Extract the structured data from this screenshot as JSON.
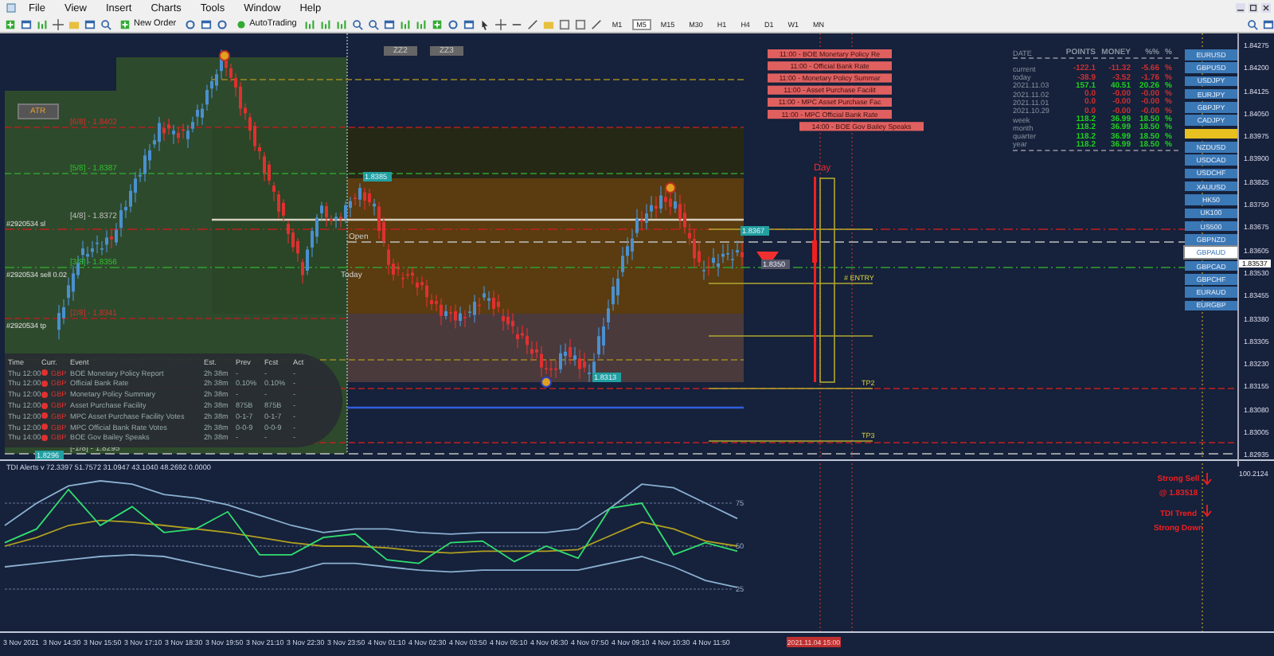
{
  "menu": [
    "File",
    "View",
    "Insert",
    "Charts",
    "Tools",
    "Window",
    "Help"
  ],
  "toolbar": {
    "new_order": "New Order",
    "autotrading": "AutoTrading",
    "timeframes": [
      {
        "label": "M1",
        "selected": false
      },
      {
        "label": "M5",
        "selected": true
      },
      {
        "label": "M15",
        "selected": false
      },
      {
        "label": "M30",
        "selected": false
      },
      {
        "label": "H1",
        "selected": false
      },
      {
        "label": "H4",
        "selected": false
      },
      {
        "label": "D1",
        "selected": false
      },
      {
        "label": "W1",
        "selected": false
      },
      {
        "label": "MN",
        "selected": false
      }
    ]
  },
  "chart": {
    "atr_button": "ATR",
    "zone_buttons": [
      "ZZ2",
      "ZZ3"
    ],
    "level_labels": [
      "[6/8] - 1.8402",
      "[5/8] - 1.8387",
      "[4/8] - 1.8372",
      "[3/8] - 1.8356",
      "[2/8] - 1.8341",
      "[-1/8] - 1.8295"
    ],
    "order_labels": [
      "#2920534 sl",
      "#2920534 sell 0.02",
      "#2920534 tp"
    ],
    "markers": [
      "Open",
      "Today"
    ],
    "price_tags": [
      "1.8385",
      "1.8367",
      "1.8350",
      "1.8313",
      "1.8296"
    ],
    "trade_labels": [
      "Day",
      "# ENTRY",
      "TP2",
      "TP3"
    ],
    "event_labels": [
      "11:00 - BOE Monetary Policy Re",
      "11:00 - Official Bank Rate",
      "11:00 - Monetary Policy Summar",
      "11:00 - Asset Purchase Facilit",
      "11:00 - MPC Asset Purchase Fac",
      "11:00 - MPC Official Bank Rate",
      "14:00 - BOE Gov Bailey Speaks"
    ],
    "news": {
      "columns": [
        "Time",
        "Curr.",
        "Event",
        "Est.",
        "Prev",
        "Fcst",
        "Act"
      ],
      "rows": [
        {
          "time": "Thu 12:00",
          "currency": "GBP",
          "event": "BOE Monetary Policy Report",
          "est": "2h 38m",
          "prev": "-",
          "fcst": "-",
          "act": "-"
        },
        {
          "time": "Thu 12:00",
          "currency": "GBP",
          "event": "Official Bank Rate",
          "est": "2h 38m",
          "prev": "0.10%",
          "fcst": "0.10%",
          "act": "-"
        },
        {
          "time": "Thu 12:00",
          "currency": "GBP",
          "event": "Monetary Policy Summary",
          "est": "2h 38m",
          "prev": "-",
          "fcst": "-",
          "act": "-"
        },
        {
          "time": "Thu 12:00",
          "currency": "GBP",
          "event": "Asset Purchase Facility",
          "est": "2h 38m",
          "prev": "875B",
          "fcst": "875B",
          "act": "-"
        },
        {
          "time": "Thu 12:00",
          "currency": "GBP",
          "event": "MPC Asset Purchase Facility Votes",
          "est": "2h 38m",
          "prev": "0-1-7",
          "fcst": "0-1-7",
          "act": "-"
        },
        {
          "time": "Thu 12:00",
          "currency": "GBP",
          "event": "MPC Official Bank Rate Votes",
          "est": "2h 38m",
          "prev": "0-0-9",
          "fcst": "0-0-9",
          "act": "-"
        },
        {
          "time": "Thu 14:00",
          "currency": "GBP",
          "event": "BOE Gov Bailey Speaks",
          "est": "2h 38m",
          "prev": "-",
          "fcst": "-",
          "act": "-"
        }
      ]
    },
    "stats": {
      "columns": [
        "DATE",
        "POINTS",
        "MONEY",
        "%%",
        "%"
      ],
      "rows": [
        {
          "label": "current",
          "points": "-122.1",
          "money": "-11.32",
          "pct": "-5.66",
          "unit": "%",
          "color": "#d03030"
        },
        {
          "label": "today",
          "points": "-38.9",
          "money": "-3.52",
          "pct": "-1.76",
          "unit": "%",
          "color": "#d03030"
        },
        {
          "label": "2021.11.03",
          "points": "157.1",
          "money": "40.51",
          "pct": "20.26",
          "unit": "%",
          "color": "#20d020"
        },
        {
          "label": "2021.11.02",
          "points": "0.0",
          "money": "-0.00",
          "pct": "-0.00",
          "unit": "%",
          "color": "#d03030"
        },
        {
          "label": "2021.11.01",
          "points": "0.0",
          "money": "-0.00",
          "pct": "-0.00",
          "unit": "%",
          "color": "#d03030"
        },
        {
          "label": "2021.10.29",
          "points": "0.0",
          "money": "-0.00",
          "pct": "-0.00",
          "unit": "%",
          "color": "#d03030"
        },
        {
          "label": "week",
          "points": "118.2",
          "money": "36.99",
          "pct": "18.50",
          "unit": "%",
          "color": "#20d020"
        },
        {
          "label": "month",
          "points": "118.2",
          "money": "36.99",
          "pct": "18.50",
          "unit": "%",
          "color": "#20d020"
        },
        {
          "label": "quarter",
          "points": "118.2",
          "money": "36.99",
          "pct": "18.50",
          "unit": "%",
          "color": "#20d020"
        },
        {
          "label": "year",
          "points": "118.2",
          "money": "36.99",
          "pct": "18.50",
          "unit": "%",
          "color": "#20d020"
        }
      ]
    },
    "symbols": [
      {
        "label": "EURUSD",
        "selected": false
      },
      {
        "label": "GBPUSD",
        "selected": false
      },
      {
        "label": "USDJPY",
        "selected": false
      },
      {
        "label": "EURJPY",
        "selected": false
      },
      {
        "label": "GBPJPY",
        "selected": false
      },
      {
        "label": "CADJPY",
        "selected": false
      },
      {
        "label": "NZDUSD",
        "selected": false
      },
      {
        "label": "USDCAD",
        "selected": false
      },
      {
        "label": "USDCHF",
        "selected": false
      },
      {
        "label": "XAUUSD",
        "selected": false
      },
      {
        "label": "HK50",
        "selected": false
      },
      {
        "label": "UK100",
        "selected": false
      },
      {
        "label": "US500",
        "selected": false
      },
      {
        "label": "GBPNZD",
        "selected": false
      },
      {
        "label": "GBPAUD",
        "selected": true
      },
      {
        "label": "GBPCAD",
        "selected": false
      },
      {
        "label": "GBPCHF",
        "selected": false
      },
      {
        "label": "EURAUD",
        "selected": false
      },
      {
        "label": "EURGBP",
        "selected": false
      }
    ],
    "price_axis": [
      "1.84275",
      "1.84200",
      "1.84125",
      "1.84050",
      "1.83975",
      "1.83900",
      "1.83825",
      "1.83750",
      "1.83675",
      "1.83605",
      "1.83530",
      "1.83455",
      "1.83380",
      "1.83305",
      "1.83230",
      "1.83155",
      "1.83080",
      "1.83005",
      "1.82935"
    ],
    "current_price": "1.83537"
  },
  "indicator": {
    "title": "TDI Alerts v 72.3397 51.7572 31.0947 43.1040 48.2692 0.0000",
    "chart_data": {
      "type": "line",
      "grid": true,
      "ylim": [
        0,
        100
      ],
      "yticks": [
        25,
        50,
        75
      ],
      "series": [
        {
          "color": "#8ab0d0",
          "values": [
            62,
            75,
            85,
            88,
            86,
            80,
            78,
            74,
            68,
            62,
            58,
            60,
            60,
            58,
            57,
            58,
            58,
            58,
            60,
            72,
            86,
            84,
            75,
            66
          ]
        },
        {
          "color": "#8ab0d0",
          "values": [
            38,
            40,
            42,
            44,
            45,
            44,
            40,
            36,
            32,
            35,
            40,
            40,
            38,
            36,
            35,
            36,
            36,
            36,
            36,
            40,
            44,
            38,
            30,
            26
          ]
        },
        {
          "color": "#b0a020",
          "values": [
            50,
            55,
            62,
            65,
            64,
            62,
            60,
            58,
            55,
            52,
            50,
            50,
            49,
            47,
            46,
            47,
            47,
            47,
            48,
            56,
            64,
            60,
            53,
            50
          ]
        },
        {
          "color": "#30e070",
          "values": [
            52,
            60,
            83,
            62,
            73,
            58,
            60,
            70,
            45,
            45,
            55,
            57,
            42,
            40,
            52,
            53,
            41,
            50,
            43,
            72,
            75,
            45,
            52,
            47
          ]
        }
      ]
    },
    "axis_max": "100.2124",
    "signals": [
      "Strong Sell",
      "@ 1.83518",
      "TDI Trend",
      "Strong Down"
    ]
  },
  "time_axis": {
    "labels": [
      "3 Nov 2021",
      "3 Nov 14:30",
      "3 Nov 15:50",
      "3 Nov 17:10",
      "3 Nov 18:30",
      "3 Nov 19:50",
      "3 Nov 21:10",
      "3 Nov 22:30",
      "3 Nov 23:50",
      "4 Nov 01:10",
      "4 Nov 02:30",
      "4 Nov 03:50",
      "4 Nov 05:10",
      "4 Nov 06:30",
      "4 Nov 07:50",
      "4 Nov 09:10",
      "4 Nov 10:30",
      "4 Nov 11:50"
    ],
    "marker": "2021.11.04 15:00"
  }
}
